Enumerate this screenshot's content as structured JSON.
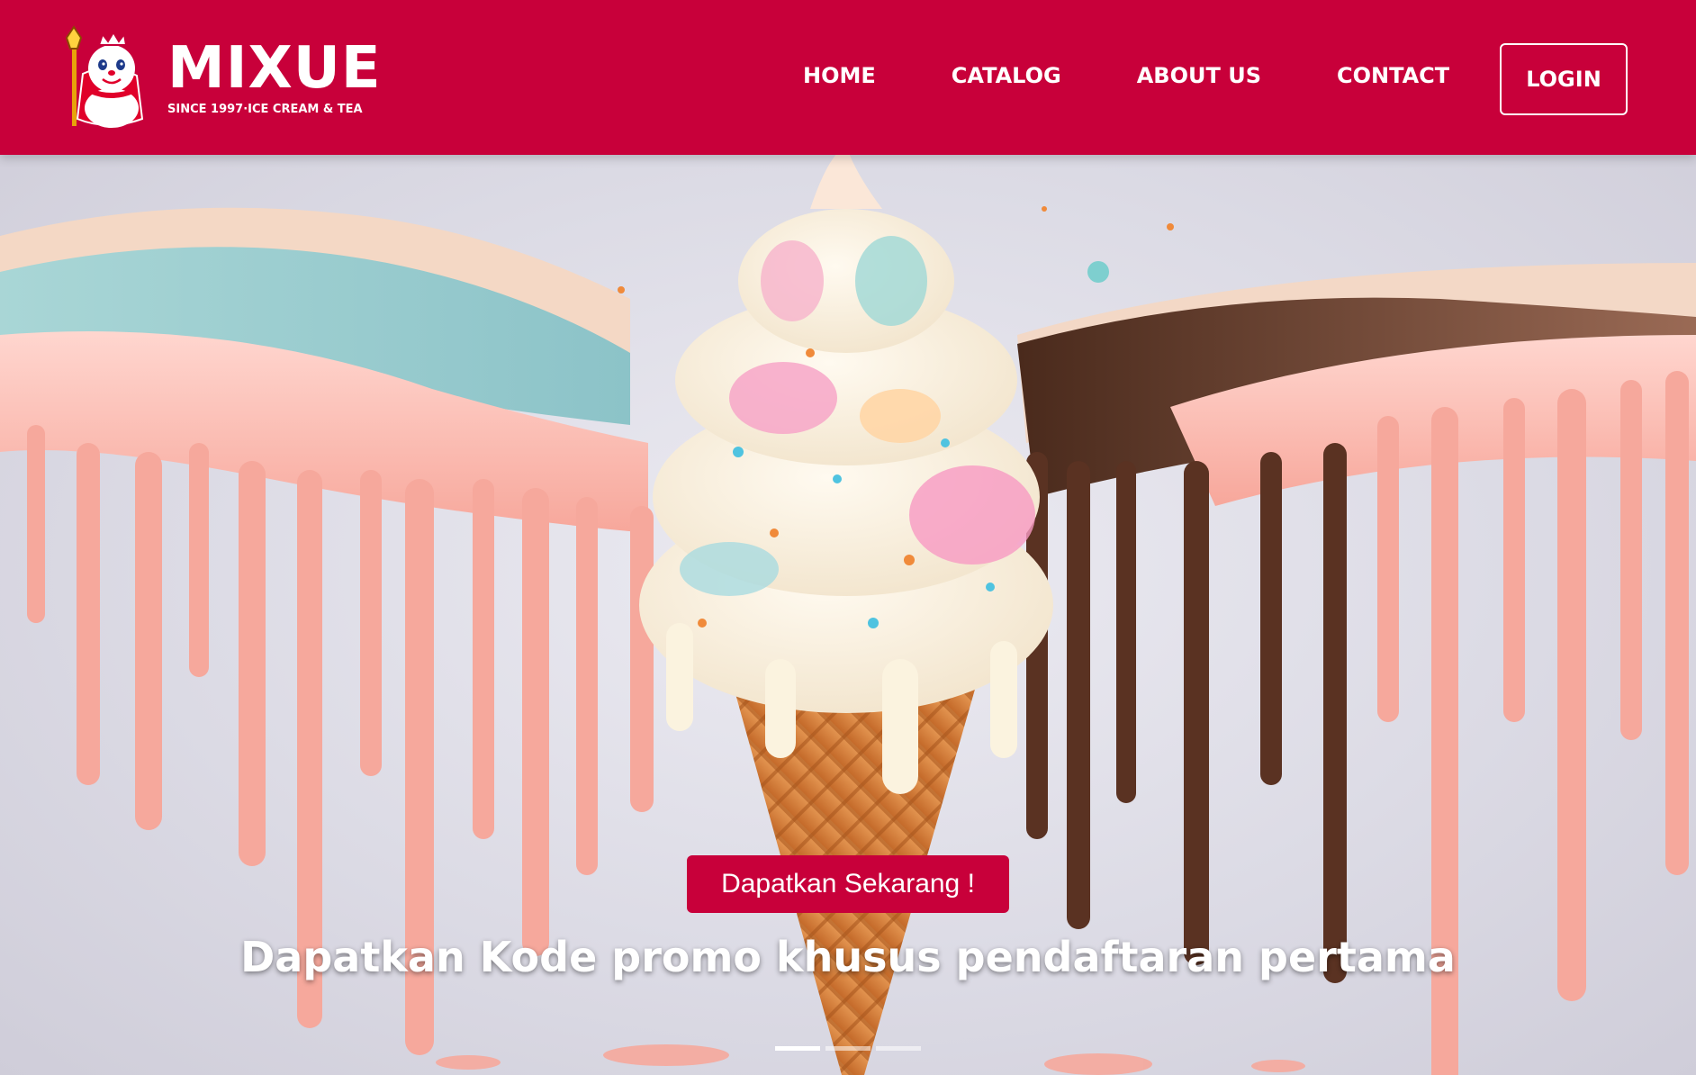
{
  "brand": {
    "name": "MIXUE",
    "tagline": "SINCE 1997·ICE CREAM & TEA",
    "logo_icon": "snowman-king-mascot-icon"
  },
  "nav": {
    "items": [
      {
        "label": "HOME"
      },
      {
        "label": "CATALOG"
      },
      {
        "label": "ABOUT US"
      },
      {
        "label": "CONTACT"
      }
    ],
    "login_label": "LOGIN"
  },
  "hero": {
    "cta_label": "Dapatkan Sekarang !",
    "promo_text": "Dapatkan Kode promo khusus pendaftaran pertama",
    "image": "ice-cream-cone-drip-splash",
    "slides": {
      "count": 3,
      "active_index": 0
    }
  },
  "colors": {
    "brand": "#c8003a",
    "text_on_brand": "#ffffff",
    "hero_background": "#dcdbe5"
  }
}
